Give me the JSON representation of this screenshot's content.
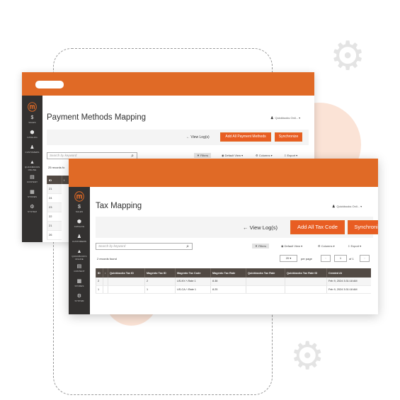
{
  "back_window": {
    "page_title": "Payment Methods Mapping",
    "user_label": "Quickbooks Onli...",
    "view_logs_label": "View Log(s)",
    "add_button_label": "Add All Payment Methods",
    "sync_button_label": "Synchronize",
    "search_placeholder": "Search by keyword",
    "filters_label": "Filters",
    "default_view_label": "Default View",
    "columns_label": "Columns",
    "export_label": "Export",
    "records_label": "25 records fo",
    "table_headers": [
      "ID",
      "↕",
      "Q"
    ],
    "rows": [
      [
        "21"
      ],
      [
        "24"
      ],
      [
        "23"
      ],
      [
        "22"
      ],
      [
        "21"
      ],
      [
        "26"
      ]
    ],
    "sidebar": [
      {
        "icon": "$",
        "label": "SALES"
      },
      {
        "icon": "⬢",
        "label": "CATALOG"
      },
      {
        "icon": "♟",
        "label": "CUSTOMERS"
      },
      {
        "icon": "▲",
        "label": "QUICKBOOKS ONLINE"
      },
      {
        "icon": "▤",
        "label": "CONTENT"
      },
      {
        "icon": "▦",
        "label": "STORES"
      },
      {
        "icon": "⚙",
        "label": "SYSTEM"
      }
    ]
  },
  "front_window": {
    "page_title": "Tax Mapping",
    "user_label": "Quickbooks Onli...",
    "view_logs_label": "View Log(s)",
    "add_button_label": "Add All Tax Code",
    "sync_button_label": "Synchronize",
    "search_placeholder": "Search by keyword",
    "filters_label": "Filters",
    "default_view_label": "Default View",
    "columns_label": "Columns",
    "export_label": "Export",
    "records_label": "2 records found",
    "per_page_value": "20",
    "per_page_label": "per page",
    "page_current": "1",
    "page_of": "of 1",
    "table_headers": [
      "ID",
      "↕",
      "Quickbooks Tax ID",
      "Magento Tax ID",
      "Magento Tax Code",
      "Magento Tax Rate",
      "Quickbooks Tax Rate",
      "Quickbooks Tax Rate ID",
      "Created At"
    ],
    "rows": [
      [
        "2",
        "",
        "",
        "2",
        "US-NY-*-Rate 1",
        "8.38",
        "",
        "",
        "Feb 9, 2024 3:31:18 AM"
      ],
      [
        "1",
        "",
        "",
        "1",
        "US-CA-*-Rate 1",
        "8.25",
        "",
        "",
        "Feb 9, 2024 3:31:18 AM"
      ]
    ],
    "sidebar": [
      {
        "icon": "$",
        "label": "SALES"
      },
      {
        "icon": "⬢",
        "label": "CATALOG"
      },
      {
        "icon": "♟",
        "label": "CUSTOMERS"
      },
      {
        "icon": "▲",
        "label": "QUICKBOOKS ONLINE"
      },
      {
        "icon": "▤",
        "label": "CONTENT"
      },
      {
        "icon": "▦",
        "label": "STORES"
      },
      {
        "icon": "⚙",
        "label": "SYSTEM"
      }
    ]
  },
  "colors": {
    "accent_orange": "#e06a26",
    "button_orange": "#e85d22",
    "sidebar_dark": "#333130",
    "table_header": "#514943"
  }
}
